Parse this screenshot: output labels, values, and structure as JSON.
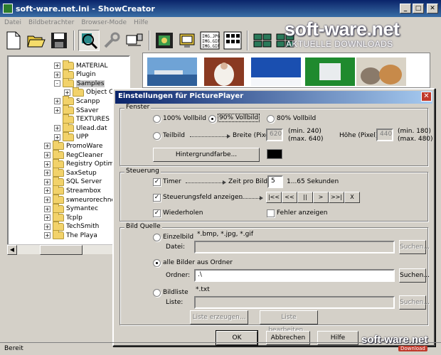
{
  "window": {
    "title": "soft-ware.net.ini - ShowCreator"
  },
  "menu": [
    "Datei",
    "Bildbetrachter",
    "Browser-Mode",
    "Hilfe"
  ],
  "watermark": {
    "name": "soft-ware.net",
    "tagline": "AKTUELLE DOWNLOADS"
  },
  "tree": {
    "items": [
      {
        "label": "MATERIAL",
        "indent": 1,
        "exp": "+"
      },
      {
        "label": "Plugin",
        "indent": 1,
        "exp": "+"
      },
      {
        "label": "Samples",
        "indent": 1,
        "exp": "-",
        "selected": true
      },
      {
        "label": "Object Cl",
        "indent": 2,
        "exp": "+"
      },
      {
        "label": "Scanpp",
        "indent": 1,
        "exp": "+"
      },
      {
        "label": "SSaver",
        "indent": 1,
        "exp": "+"
      },
      {
        "label": "TEXTURES",
        "indent": 1,
        "exp": ""
      },
      {
        "label": "Ulead.dat",
        "indent": 1,
        "exp": "+"
      },
      {
        "label": "UPP",
        "indent": 1,
        "exp": "+"
      },
      {
        "label": "PromoWare",
        "indent": 0,
        "exp": "+"
      },
      {
        "label": "RegCleaner",
        "indent": 0,
        "exp": "+"
      },
      {
        "label": "Registry Optimizer",
        "indent": 0,
        "exp": "+"
      },
      {
        "label": "SaxSetup",
        "indent": 0,
        "exp": "+"
      },
      {
        "label": "SQL Server",
        "indent": 0,
        "exp": "+"
      },
      {
        "label": "Streambox",
        "indent": 0,
        "exp": "+"
      },
      {
        "label": "swneurorechner",
        "indent": 0,
        "exp": "+"
      },
      {
        "label": "Symantec",
        "indent": 0,
        "exp": "+"
      },
      {
        "label": "Tcplp",
        "indent": 0,
        "exp": "+"
      },
      {
        "label": "TechSmith",
        "indent": 0,
        "exp": "+"
      },
      {
        "label": "The Playa",
        "indent": 0,
        "exp": "+"
      }
    ]
  },
  "status": {
    "text": "Bereit"
  },
  "overlay_logo": {
    "name": "soft-ware.net",
    "badge": "Download"
  },
  "dialog": {
    "title": "Einstellungen für PicturePlayer",
    "fenster": {
      "label": "Fenster",
      "opt_100": "100% Vollbild",
      "opt_90": "90% Vollbild",
      "opt_80": "80% Vollbild",
      "selected": "90",
      "teilbild": "Teilbild",
      "breite_label": "Breite (Pixel)",
      "breite_value": "620",
      "breite_range": "(min. 240)\n(max. 640)",
      "breite_min": "(min. 240)",
      "breite_max": "(max. 640)",
      "hoehe_label": "Höhe (Pixel)",
      "hoehe_value": "440",
      "hoehe_min": "(min. 180)",
      "hoehe_max": "(max. 480)",
      "bg_button": "Hintergrundfarbe...",
      "bg_color": "#000000"
    },
    "steuerung": {
      "label": "Steuerung",
      "timer": "Timer",
      "timer_checked": true,
      "zeit_label": "Zeit pro Bild:",
      "zeit_value": "5",
      "zeit_range": "1...65 Sekunden",
      "steuerfeld": "Steuerungsfeld anzeigen",
      "steuerfeld_checked": true,
      "controls": [
        "|<<",
        "<<",
        "||",
        ">",
        ">>|",
        "X"
      ],
      "wiederholen": "Wiederholen",
      "wiederholen_checked": true,
      "fehler": "Fehler anzeigen",
      "fehler_checked": false
    },
    "quelle": {
      "label": "Bild Quelle",
      "einzelbild": "Einzelbild",
      "einzel_types": "*.bmp, *.jpg, *.gif",
      "datei_label": "Datei:",
      "datei_value": "",
      "suchen1": "Suchen...",
      "ordner_opt": "alle Bilder aus Ordner",
      "ordner_label": "Ordner:",
      "ordner_value": ".\\",
      "suchen2": "Suchen...",
      "bildliste": "Bildliste",
      "liste_types": "*.txt",
      "liste_label": "Liste:",
      "liste_value": "",
      "suchen3": "Suchen...",
      "erzeugen": "Liste erzeugen...",
      "bearbeiten": "Liste bearbeiten...",
      "selected": "ordner"
    },
    "buttons": {
      "ok": "OK",
      "cancel": "Abbrechen",
      "help": "Hilfe"
    }
  }
}
